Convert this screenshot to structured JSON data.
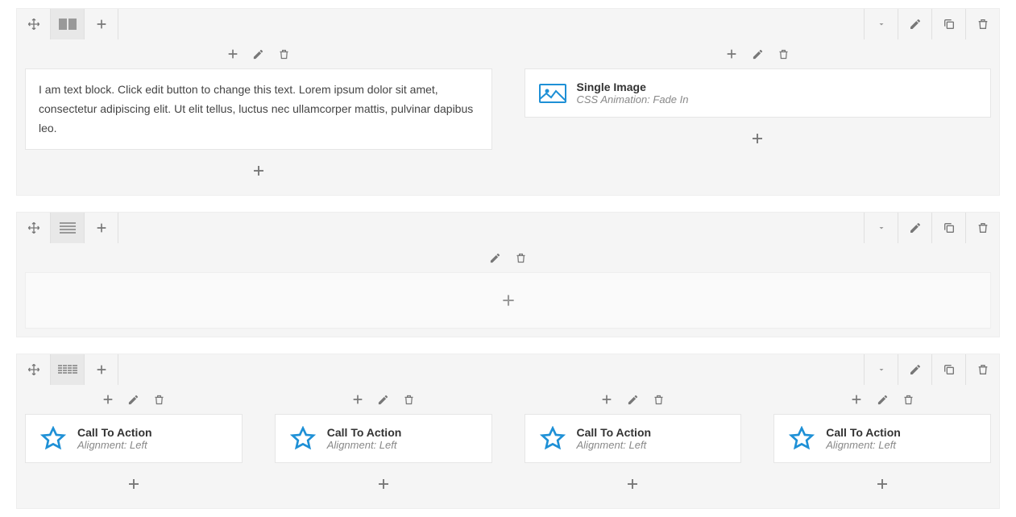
{
  "rows": [
    {
      "layout": "2col",
      "columns": [
        {
          "elements": [
            {
              "type": "text",
              "content": "I am text block. Click edit button to change this text. Lorem ipsum dolor sit amet, consectetur adipiscing elit. Ut elit tellus, luctus nec ullamcorper mattis, pulvinar dapibus leo."
            }
          ]
        },
        {
          "elements": [
            {
              "type": "icon",
              "icon": "image",
              "title": "Single Image",
              "subtitle": "CSS Animation: Fade In"
            }
          ]
        }
      ]
    },
    {
      "layout": "1col",
      "columns": [
        {
          "elements": []
        }
      ]
    },
    {
      "layout": "4col",
      "columns": [
        {
          "elements": [
            {
              "type": "icon",
              "icon": "star",
              "title": "Call To Action",
              "subtitle": "Alignment: Left"
            }
          ]
        },
        {
          "elements": [
            {
              "type": "icon",
              "icon": "star",
              "title": "Call To Action",
              "subtitle": "Alignment: Left"
            }
          ]
        },
        {
          "elements": [
            {
              "type": "icon",
              "icon": "star",
              "title": "Call To Action",
              "subtitle": "Alignment: Left"
            }
          ]
        },
        {
          "elements": [
            {
              "type": "icon",
              "icon": "star",
              "title": "Call To Action",
              "subtitle": "Alignment: Left"
            }
          ]
        }
      ]
    }
  ]
}
